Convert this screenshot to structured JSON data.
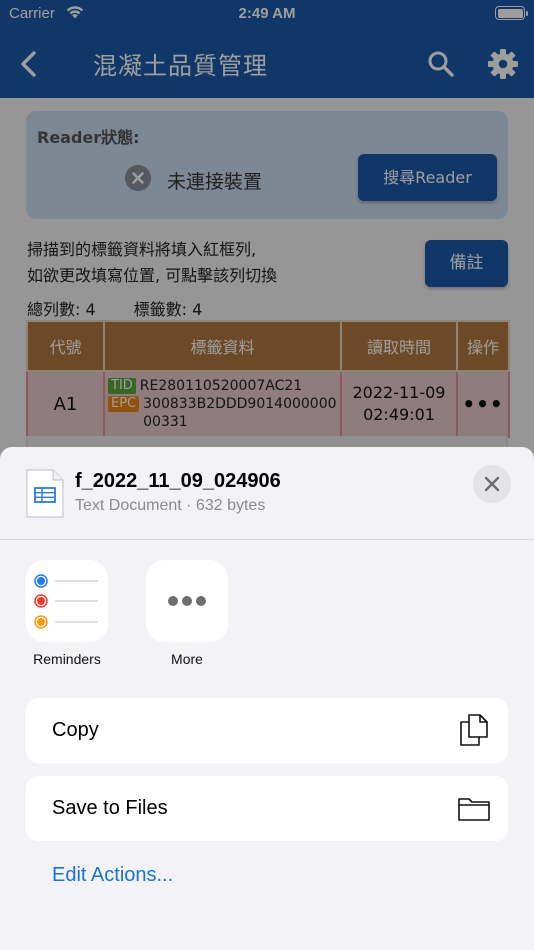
{
  "status_bar": {
    "carrier": "Carrier",
    "time": "2:49 AM"
  },
  "nav": {
    "title": "混凝土品質管理"
  },
  "reader": {
    "label": "Reader狀態:",
    "status": "未連接裝置",
    "search_button": "搜尋Reader"
  },
  "hint": {
    "line1": "掃描到的標籤資料將填入紅框列,",
    "line2": "如欲更改填寫位置, 可點擊該列切換"
  },
  "note_button": "備註",
  "counts": {
    "rows": "總列數: 4",
    "tags": "標籤數: 4"
  },
  "table": {
    "headers": [
      "代號",
      "標籤資料",
      "讀取時間",
      "操作"
    ],
    "rows": [
      {
        "code": "A1",
        "tid_tag": "TID",
        "tid": "RE280110520007AC21",
        "epc_tag": "EPC",
        "epc": "300833B2DDD901400000000331",
        "time_date": "2022-11-09",
        "time_clock": "02:49:01",
        "ops": "•••"
      }
    ]
  },
  "share_sheet": {
    "file_name": "f_2022_11_09_024906",
    "file_meta": "Text Document · 632 bytes",
    "apps": [
      {
        "label": "Reminders",
        "icon": "reminders-icon"
      },
      {
        "label": "More",
        "icon": "more-icon"
      }
    ],
    "actions": [
      {
        "label": "Copy",
        "icon": "copy-icon"
      },
      {
        "label": "Save to Files",
        "icon": "folder-icon"
      }
    ],
    "edit_actions": "Edit Actions..."
  },
  "colors": {
    "nav_blue": "#1a5aa8",
    "header_brown": "#b0783f",
    "selected_row": "#e58d96",
    "link_blue": "#1a72d6"
  }
}
